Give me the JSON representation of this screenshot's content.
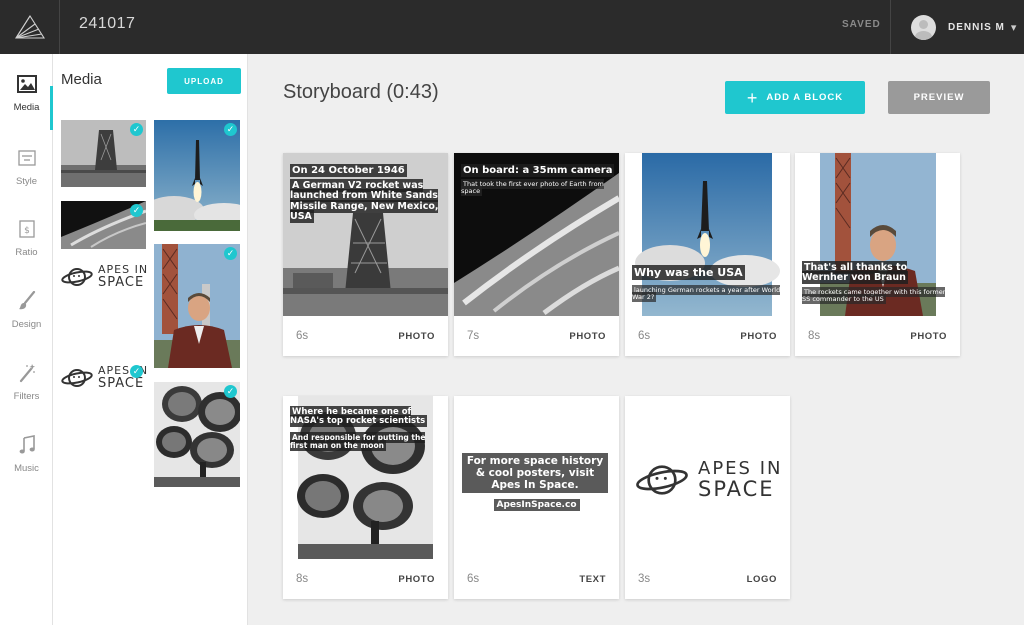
{
  "header": {
    "project_title": "241017",
    "save_status": "SAVED",
    "user_name": "DENNIS M"
  },
  "toolbar": {
    "items": [
      {
        "label": "Media",
        "icon": "image-icon",
        "active": true
      },
      {
        "label": "Style",
        "icon": "style-icon",
        "active": false
      },
      {
        "label": "Ratio",
        "icon": "ratio-icon",
        "active": false
      },
      {
        "label": "Design",
        "icon": "brush-icon",
        "active": false
      },
      {
        "label": "Filters",
        "icon": "magic-wand-icon",
        "active": false
      },
      {
        "label": "Music",
        "icon": "music-note-icon",
        "active": false
      }
    ]
  },
  "media_panel": {
    "title": "Media",
    "upload_label": "UPLOAD",
    "logo_line1": "APES IN",
    "logo_line2": "SPACE"
  },
  "storyboard": {
    "title": "Storyboard (0:43)",
    "add_block_label": "ADD A BLOCK",
    "preview_label": "PREVIEW",
    "blocks": [
      {
        "duration": "6s",
        "type": "PHOTO",
        "caption_title": "On 24 October 1946",
        "caption_text": "A German V2 rocket was launched from White Sands Missile Range, New Mexico, USA"
      },
      {
        "duration": "7s",
        "type": "PHOTO",
        "caption_title": "On board: a 35mm camera",
        "caption_text": "That took the first ever photo of Earth from space"
      },
      {
        "duration": "6s",
        "type": "PHOTO",
        "caption_title": "Why was the USA",
        "caption_text": "launching German rockets a year after World War 2?"
      },
      {
        "duration": "8s",
        "type": "PHOTO",
        "caption_title": "That's all thanks to Wernher von Braun",
        "caption_text": "The rockets came together with this former SS commander to the US"
      },
      {
        "duration": "8s",
        "type": "PHOTO",
        "caption_title": "Where he became one of NASA's top rocket scientists",
        "caption_text": "And responsible for putting the first man on the moon"
      },
      {
        "duration": "6s",
        "type": "TEXT",
        "caption_title": "For more space history & cool posters, visit Apes In Space.",
        "caption_text": "ApesInSpace.co"
      },
      {
        "duration": "3s",
        "type": "LOGO",
        "caption_title": "APES IN",
        "caption_text": "SPACE"
      }
    ]
  },
  "colors": {
    "accent": "#1fc7cf",
    "topbar": "#2b2b2b",
    "preview_button": "#9a9a9a"
  }
}
